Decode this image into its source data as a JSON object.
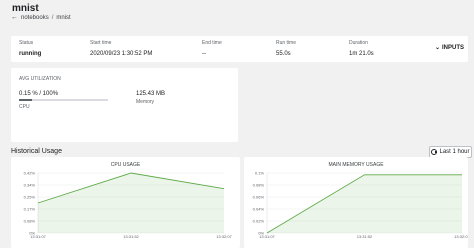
{
  "header": {
    "title": "mnist",
    "breadcrumb": {
      "parent": "notebooks",
      "separator": "/",
      "current": "mnist"
    }
  },
  "status": {
    "items": [
      {
        "label": "Status",
        "value": "running"
      },
      {
        "label": "Start time",
        "value": "2020/09/23 1:30:52 PM"
      },
      {
        "label": "End time",
        "value": "--"
      },
      {
        "label": "Run time",
        "value": "55.0s"
      },
      {
        "label": "Duration",
        "value": "1m 21.0s"
      }
    ],
    "inputs_label": "INPUTS"
  },
  "utilization": {
    "label": "AVG UTILIZATION",
    "cpu_value": "0.15 % / 100%",
    "cpu_fraction": 0.15,
    "cpu_caption": "CPU",
    "memory_value": "125.43 MB",
    "memory_caption": "Memory"
  },
  "history": {
    "title": "Historical Usage",
    "range_button": "Last 1 hour"
  },
  "chart_data": [
    {
      "type": "area",
      "title": "CPU USAGE",
      "y_ticks": [
        "0.42%",
        "0.34%",
        "0.25%",
        "0.17%",
        "0.08%",
        "0%"
      ],
      "x_ticks": [
        "13:31:07",
        "13:31:52",
        "13:32:07"
      ],
      "ylim": [
        0,
        0.42
      ],
      "x": [
        0,
        1,
        2
      ],
      "values": [
        0.21,
        0.42,
        0.31
      ],
      "color": "#5eab48"
    },
    {
      "type": "area",
      "title": "MAIN MEMORY USAGE",
      "y_ticks": [
        "0.1%",
        "0.08%",
        "0.06%",
        "0.04%",
        "0.02%",
        "0%"
      ],
      "x_ticks": [
        "13:31:07",
        "13:31:52",
        "13:32:07"
      ],
      "ylim": [
        0,
        0.1
      ],
      "x": [
        0,
        1,
        2
      ],
      "values": [
        0,
        0.097,
        0.097
      ],
      "color": "#5eab48"
    }
  ]
}
